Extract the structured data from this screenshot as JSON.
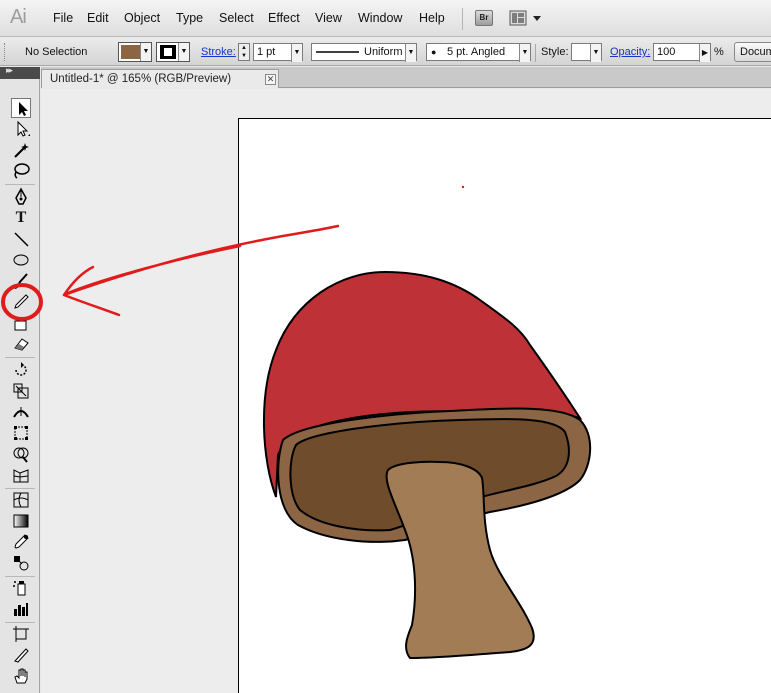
{
  "app": {
    "logo_text": "Ai"
  },
  "menu": {
    "items": [
      "File",
      "Edit",
      "Object",
      "Type",
      "Select",
      "Effect",
      "View",
      "Window",
      "Help"
    ],
    "bridge_label": "Br"
  },
  "control_bar": {
    "selection_text": "No Selection",
    "fill_color": "#8b6544",
    "stroke_color": "#000000",
    "stroke_label": "Stroke:",
    "stroke_weight": "1 pt",
    "variable_width_profile": "Uniform",
    "brush_definition": "5 pt. Angled",
    "style_label": "Style:",
    "opacity_label": "Opacity:",
    "opacity_value": "100",
    "opacity_unit": "%",
    "document_setup_label": "Docum"
  },
  "document": {
    "tab_title": "Untitled-1* @ 165% (RGB/Preview)",
    "close_glyph": "✕"
  },
  "tools": [
    "selection-tool",
    "direct-selection-tool",
    "magic-wand-tool",
    "lasso-tool",
    "pen-tool",
    "type-tool",
    "line-segment-tool",
    "ellipse-tool",
    "paintbrush-tool",
    "pencil-tool",
    "blob-brush-tool",
    "eraser-tool",
    "rotate-tool",
    "scale-tool",
    "width-tool",
    "free-transform-tool",
    "shape-builder-tool",
    "perspective-grid-tool",
    "mesh-tool",
    "gradient-tool",
    "eyedropper-tool",
    "blend-tool",
    "symbol-sprayer-tool",
    "column-graph-tool",
    "artboard-tool",
    "slice-tool",
    "hand-tool"
  ],
  "colors": {
    "mushroom_cap": "#be3237",
    "mushroom_gill_outer": "#8b6544",
    "mushroom_gill_inner": "#6f4c2b",
    "mushroom_stem": "#a27c55",
    "annotation_red": "#e01b1b"
  }
}
